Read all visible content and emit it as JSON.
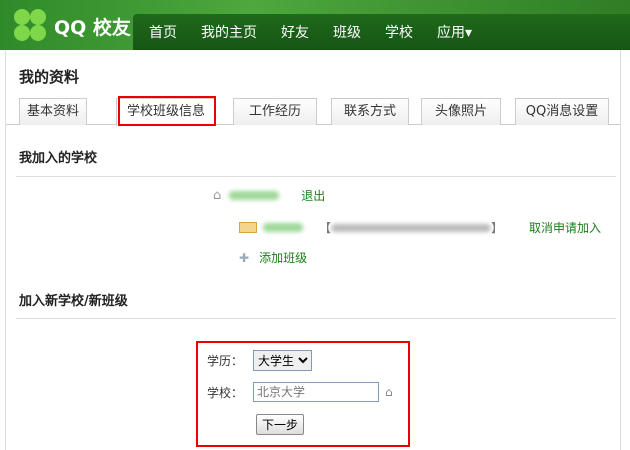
{
  "header": {
    "logo_text": "QQ 校友",
    "nav": [
      "首页",
      "我的主页",
      "好友",
      "班级",
      "学校",
      "应用▾"
    ]
  },
  "page": {
    "title": "我的资料",
    "tabs": [
      "基本资料",
      "学校班级信息",
      "工作经历",
      "联系方式",
      "头像照片",
      "QQ消息设置"
    ],
    "joined": {
      "heading": "我加入的学校",
      "quit": "退出",
      "cancel": "取消申请加入",
      "add_class": "添加班级"
    },
    "join_new": {
      "heading": "加入新学校/新班级",
      "edu_label": "学历：",
      "edu_value": "大学生",
      "school_label": "学校：",
      "school_placeholder": "北京大学",
      "next": "下一步"
    }
  }
}
